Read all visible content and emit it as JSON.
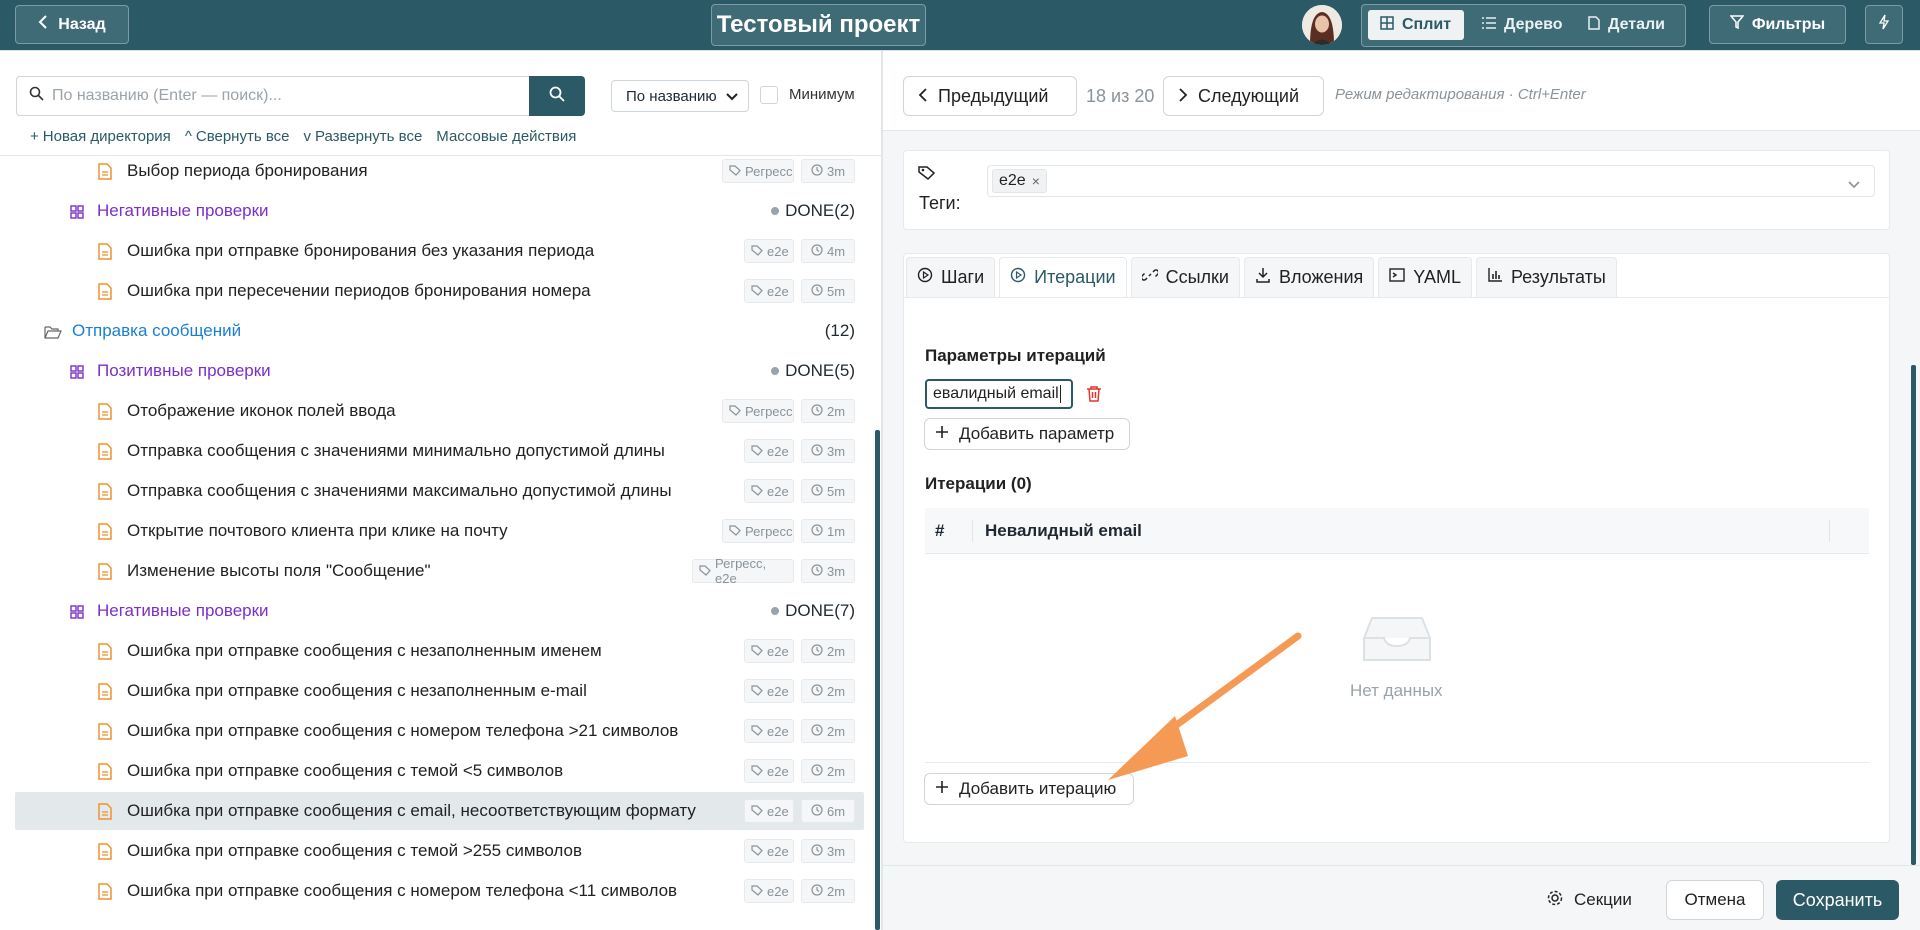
{
  "topbar": {
    "back_label": "Назад",
    "project_title": "Тестовый проект",
    "view_modes": [
      "Сплит",
      "Дерево",
      "Детали"
    ],
    "filters_label": "Фильтры"
  },
  "left": {
    "search_placeholder": "По названию (Enter — поиск)...",
    "sort_value": "По названию",
    "minimum_label": "Минимум",
    "actions": [
      "Новая директория",
      "Свернуть все",
      "Развернуть все",
      "Массовые действия"
    ]
  },
  "tree": [
    {
      "kind": "case",
      "title": "Выбор периода бронирования",
      "tags": "Регресс",
      "time": "3m"
    },
    {
      "kind": "group",
      "title": "Негативные проверки",
      "status": "DONE",
      "count": "(2)"
    },
    {
      "kind": "case",
      "title": "Ошибка при отправке бронирования без указания периода",
      "tags": "e2e",
      "time": "4m"
    },
    {
      "kind": "case",
      "title": "Ошибка при пересечении периодов бронирования номера",
      "tags": "e2e",
      "time": "5m"
    },
    {
      "kind": "folder",
      "title": "Отправка сообщений",
      "count": "(12)"
    },
    {
      "kind": "group",
      "title": "Позитивные проверки",
      "status": "DONE",
      "count": "(5)"
    },
    {
      "kind": "case",
      "title": "Отображение иконок полей ввода",
      "tags": "Регресс",
      "time": "2m"
    },
    {
      "kind": "case",
      "title": "Отправка сообщения с значениями минимально допустимой длины",
      "tags": "e2e",
      "time": "3m"
    },
    {
      "kind": "case",
      "title": "Отправка сообщения с значениями максимально допустимой длины",
      "tags": "e2e",
      "time": "5m"
    },
    {
      "kind": "case",
      "title": "Открытие почтового клиента при клике на почту",
      "tags": "Регресс",
      "time": "1m"
    },
    {
      "kind": "case",
      "title": "Изменение высоты поля \"Сообщение\"",
      "tags": "Регресс, e2e",
      "time": "3m"
    },
    {
      "kind": "group",
      "title": "Негативные проверки",
      "status": "DONE",
      "count": "(7)"
    },
    {
      "kind": "case",
      "title": "Ошибка при отправке сообщения с незаполненным именем",
      "tags": "e2e",
      "time": "2m"
    },
    {
      "kind": "case",
      "title": "Ошибка при отправке сообщения с незаполненным e-mail",
      "tags": "e2e",
      "time": "2m"
    },
    {
      "kind": "case",
      "title": "Ошибка при отправке сообщения с номером телефона >21 символов",
      "tags": "e2e",
      "time": "2m"
    },
    {
      "kind": "case",
      "title": "Ошибка при отправке сообщения с темой <5 символов",
      "tags": "e2e",
      "time": "2m"
    },
    {
      "kind": "case",
      "title": "Ошибка при отправке сообщения с email, несоответствующим формату",
      "tags": "e2e",
      "time": "6m",
      "selected": true
    },
    {
      "kind": "case",
      "title": "Ошибка при отправке сообщения с темой >255 символов",
      "tags": "e2e",
      "time": "3m"
    },
    {
      "kind": "case",
      "title": "Ошибка при отправке сообщения с номером телефона <11 символов",
      "tags": "e2e",
      "time": "2m"
    }
  ],
  "nav": {
    "prev_label": "Предыдущий",
    "position": "18 из 20",
    "next_label": "Следующий",
    "mode_hint": "Режим редактирования · Ctrl+Enter"
  },
  "tags_field": {
    "label": "Теги:",
    "value": "e2e"
  },
  "tabs": [
    "Шаги",
    "Итерации",
    "Ссылки",
    "Вложения",
    "YAML",
    "Результаты"
  ],
  "iterations": {
    "params_title": "Параметры итераций",
    "param_value": "евалидный email",
    "add_param_label": "Добавить параметр",
    "list_title": "Итерации (0)",
    "col_hash": "#",
    "col_name": "Невалидный email",
    "empty_text": "Нет данных",
    "add_iteration_label": "Добавить итерацию"
  },
  "footer": {
    "sections_label": "Секции",
    "cancel_label": "Отмена",
    "save_label": "Сохранить"
  },
  "colors": {
    "brand": "#2b5966",
    "accent_arrow": "#f59a55",
    "group": "#7b2fc9",
    "folder": "#1a7fd6"
  }
}
